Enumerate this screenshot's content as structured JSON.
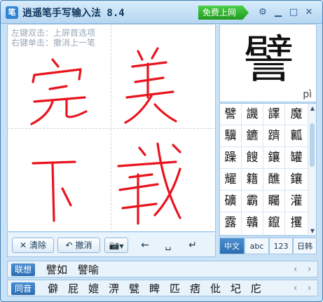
{
  "title": {
    "app_name": "逍遥笔手写输入法 8.4",
    "free_net_label": "免费上网"
  },
  "icons": {
    "settings": "gear-icon",
    "minimize": "minimize-icon",
    "maximize": "maximize-icon",
    "close": "close-icon"
  },
  "canvas": {
    "hint_line1": "左键双击：上屏首选项",
    "hint_line2": "右键单击：撤消上一笔",
    "ink_color": "#e8141e"
  },
  "toolbar": {
    "clear_label": "清除",
    "undo_label": "撤消"
  },
  "preview": {
    "char": "譬",
    "pinyin": "pì"
  },
  "candidates": [
    "譬",
    "譏",
    "譯",
    "魔",
    "驥",
    "鑣",
    "躋",
    "瓤",
    "躁",
    "餿",
    "鑲",
    "罐",
    "耀",
    "籍",
    "醮",
    "鑲",
    "礦",
    "霸",
    "矚",
    "灌",
    "露",
    "贛",
    "鑹",
    "攫"
  ],
  "modes": [
    "中文",
    "abc",
    "123",
    "日韩"
  ],
  "association": {
    "label": "联想",
    "items": [
      "譬如",
      "譬喻"
    ]
  },
  "homophone": {
    "label": "同音",
    "items": [
      "僻",
      "屁",
      "媲",
      "淠",
      "甓",
      "睥",
      "匹",
      "痞",
      "仳",
      "圮",
      "庀"
    ]
  }
}
